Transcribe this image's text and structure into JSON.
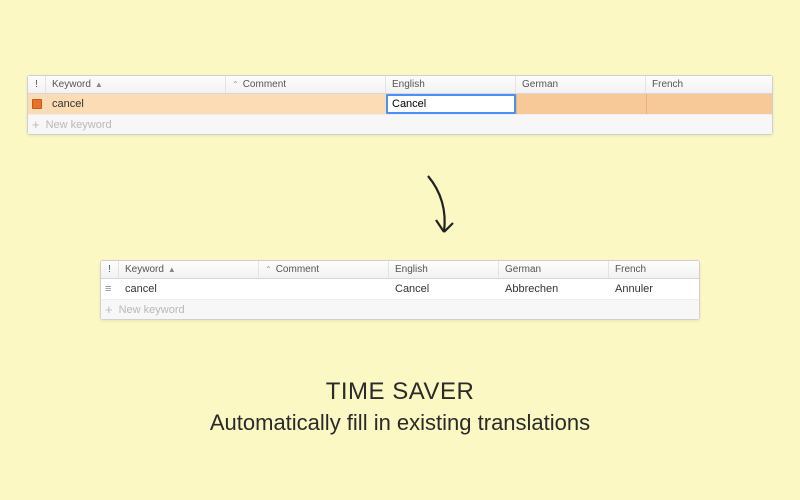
{
  "columns": {
    "keyword": "Keyword",
    "comment": "Comment",
    "english": "English",
    "german": "German",
    "french": "French"
  },
  "before": {
    "row": {
      "keyword": "cancel",
      "english": "Cancel",
      "german": "",
      "french": ""
    },
    "editing_value": "Cancel"
  },
  "after": {
    "row": {
      "keyword": "cancel",
      "english": "Cancel",
      "german": "Abbrechen",
      "french": "Annuler"
    }
  },
  "add_row": {
    "label": "New keyword"
  },
  "caption": {
    "title": "TIME SAVER",
    "subtitle": "Automatically fill in existing translations"
  }
}
